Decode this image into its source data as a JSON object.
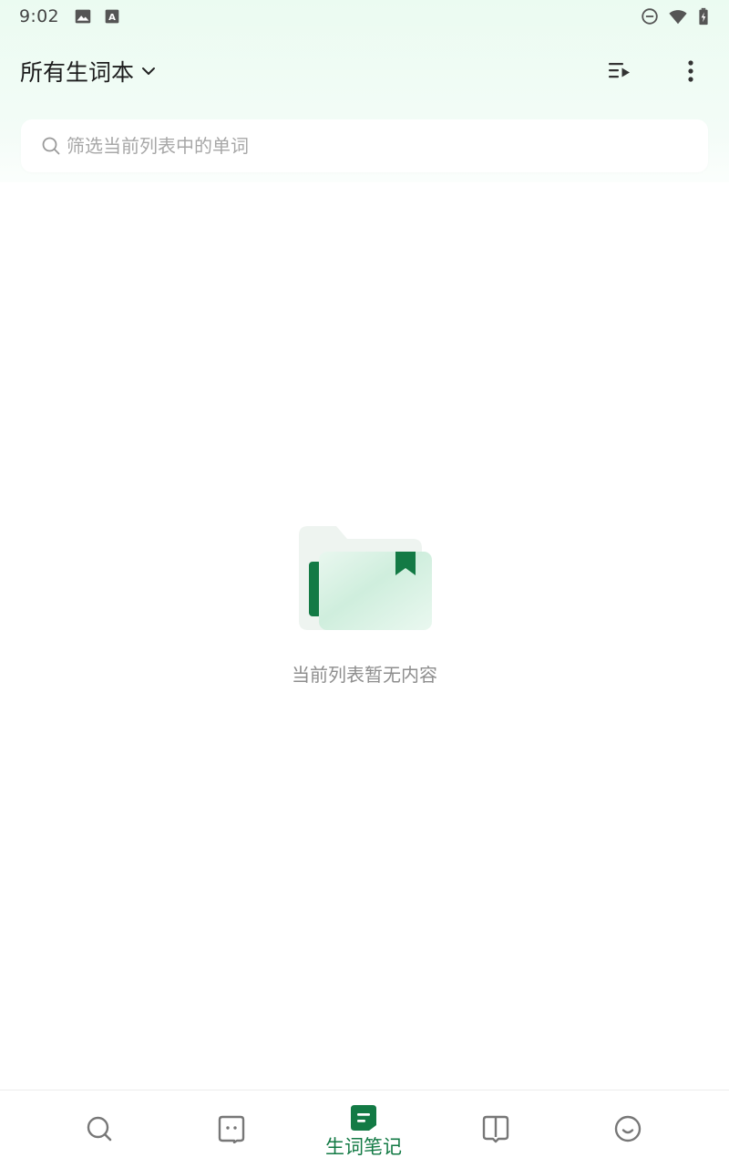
{
  "status_bar": {
    "time": "9:02",
    "left_icons": [
      "image-icon",
      "font-a-icon"
    ],
    "right_icons": [
      "do-not-disturb-icon",
      "wifi-icon",
      "battery-charging-icon"
    ]
  },
  "header": {
    "title": "所有生词本",
    "title_icon": "chevron-down-icon",
    "actions": [
      "playlist-play-icon",
      "more-vertical-icon"
    ]
  },
  "search": {
    "placeholder": "筛选当前列表中的单词",
    "value": "",
    "icon": "search-icon"
  },
  "empty_state": {
    "illustration": "folder-bookmark-icon",
    "message": "当前列表暂无内容"
  },
  "bottom_nav": {
    "items": [
      {
        "icon": "search-icon",
        "label": "",
        "active": false
      },
      {
        "icon": "chat-icon",
        "label": "",
        "active": false
      },
      {
        "icon": "note-icon",
        "label": "生词笔记",
        "active": true
      },
      {
        "icon": "book-icon",
        "label": "",
        "active": false
      },
      {
        "icon": "smile-icon",
        "label": "",
        "active": false
      }
    ]
  },
  "colors": {
    "accent": "#137a45",
    "top_background": "#ebfbf1",
    "icon_gray": "#777777",
    "text_gray": "#8e8e8e"
  }
}
